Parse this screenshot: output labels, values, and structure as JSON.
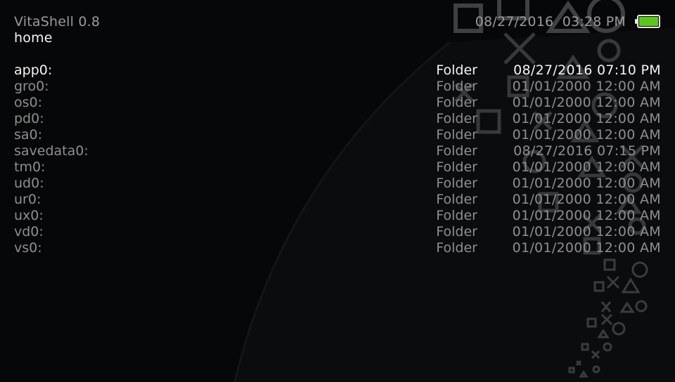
{
  "header": {
    "app_title": "VitaShell 0.8",
    "current_path": "home",
    "datetime": "08/27/2016  03:28 PM",
    "battery_level": 1.0,
    "battery_color": "#5fc41f"
  },
  "colors": {
    "selected_text": "#f4f4f4",
    "normal_text": "#8f8f8f",
    "background": "#060708"
  },
  "background_art": "playstation-shapes-icon",
  "files": [
    {
      "name": "app0:",
      "type": "Folder",
      "date": "08/27/2016 07:10 PM",
      "selected": true
    },
    {
      "name": "gro0:",
      "type": "Folder",
      "date": "01/01/2000 12:00 AM"
    },
    {
      "name": "os0:",
      "type": "Folder",
      "date": "01/01/2000 12:00 AM"
    },
    {
      "name": "pd0:",
      "type": "Folder",
      "date": "01/01/2000 12:00 AM"
    },
    {
      "name": "sa0:",
      "type": "Folder",
      "date": "01/01/2000 12:00 AM"
    },
    {
      "name": "savedata0:",
      "type": "Folder",
      "date": "08/27/2016 07:15 PM"
    },
    {
      "name": "tm0:",
      "type": "Folder",
      "date": "01/01/2000 12:00 AM"
    },
    {
      "name": "ud0:",
      "type": "Folder",
      "date": "01/01/2000 12:00 AM"
    },
    {
      "name": "ur0:",
      "type": "Folder",
      "date": "01/01/2000 12:00 AM"
    },
    {
      "name": "ux0:",
      "type": "Folder",
      "date": "01/01/2000 12:00 AM"
    },
    {
      "name": "vd0:",
      "type": "Folder",
      "date": "01/01/2000 12:00 AM"
    },
    {
      "name": "vs0:",
      "type": "Folder",
      "date": "01/01/2000 12:00 AM"
    }
  ]
}
